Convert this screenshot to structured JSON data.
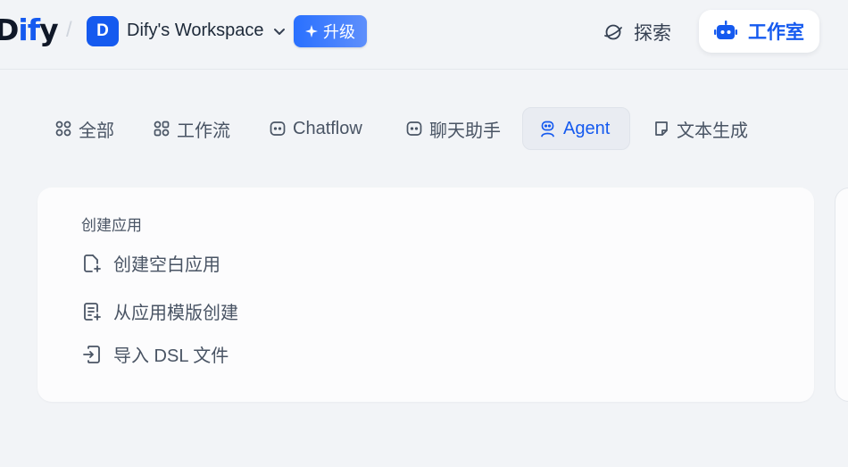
{
  "header": {
    "logo": {
      "part1": "D",
      "part2": "if",
      "part3": "y"
    },
    "workspace": {
      "avatar_letter": "D",
      "name": "Dify's Workspace"
    },
    "upgrade_label": "升级",
    "explore_label": "探索",
    "studio_label": "工作室"
  },
  "tabs": [
    {
      "label": "全部",
      "icon": "grid-icon"
    },
    {
      "label": "工作流",
      "icon": "workflow-icon"
    },
    {
      "label": "Chatflow",
      "icon": "chatbot-icon"
    },
    {
      "label": "聊天助手",
      "icon": "chat-assistant-icon"
    },
    {
      "label": "Agent",
      "icon": "agent-icon",
      "active": true
    },
    {
      "label": "文本生成",
      "icon": "document-icon"
    }
  ],
  "create_card": {
    "title": "创建应用",
    "items": [
      {
        "label": "创建空白应用",
        "icon": "file-plus-icon"
      },
      {
        "label": "从应用模版创建",
        "icon": "template-icon"
      },
      {
        "label": "导入 DSL 文件",
        "icon": "import-icon"
      }
    ]
  },
  "colors": {
    "accent": "#155aef",
    "background": "#f2f4f7",
    "card": "#fcfcfd"
  }
}
